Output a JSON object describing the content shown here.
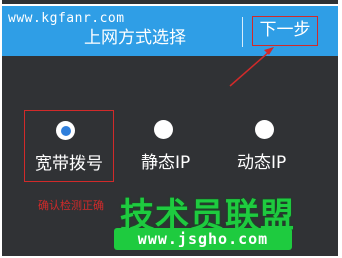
{
  "watermark_top": "www.kgfanr.com",
  "header": {
    "title": "上网方式选择",
    "next_label": "下一步"
  },
  "options": [
    {
      "label": "宽带拨号",
      "selected": true
    },
    {
      "label": "静态IP",
      "selected": false
    },
    {
      "label": "动态IP",
      "selected": false
    }
  ],
  "annotation": {
    "confirm_note": "确认检测正确"
  },
  "watermark_brand": {
    "name": "技术员联盟",
    "url": "www.jsgho.com"
  },
  "colors": {
    "header_bg": "#2f9ee6",
    "body_bg": "#303235",
    "highlight": "#d12a2a",
    "selected_dot": "#2f7fdc",
    "brand_green": "#1ecb3f"
  }
}
